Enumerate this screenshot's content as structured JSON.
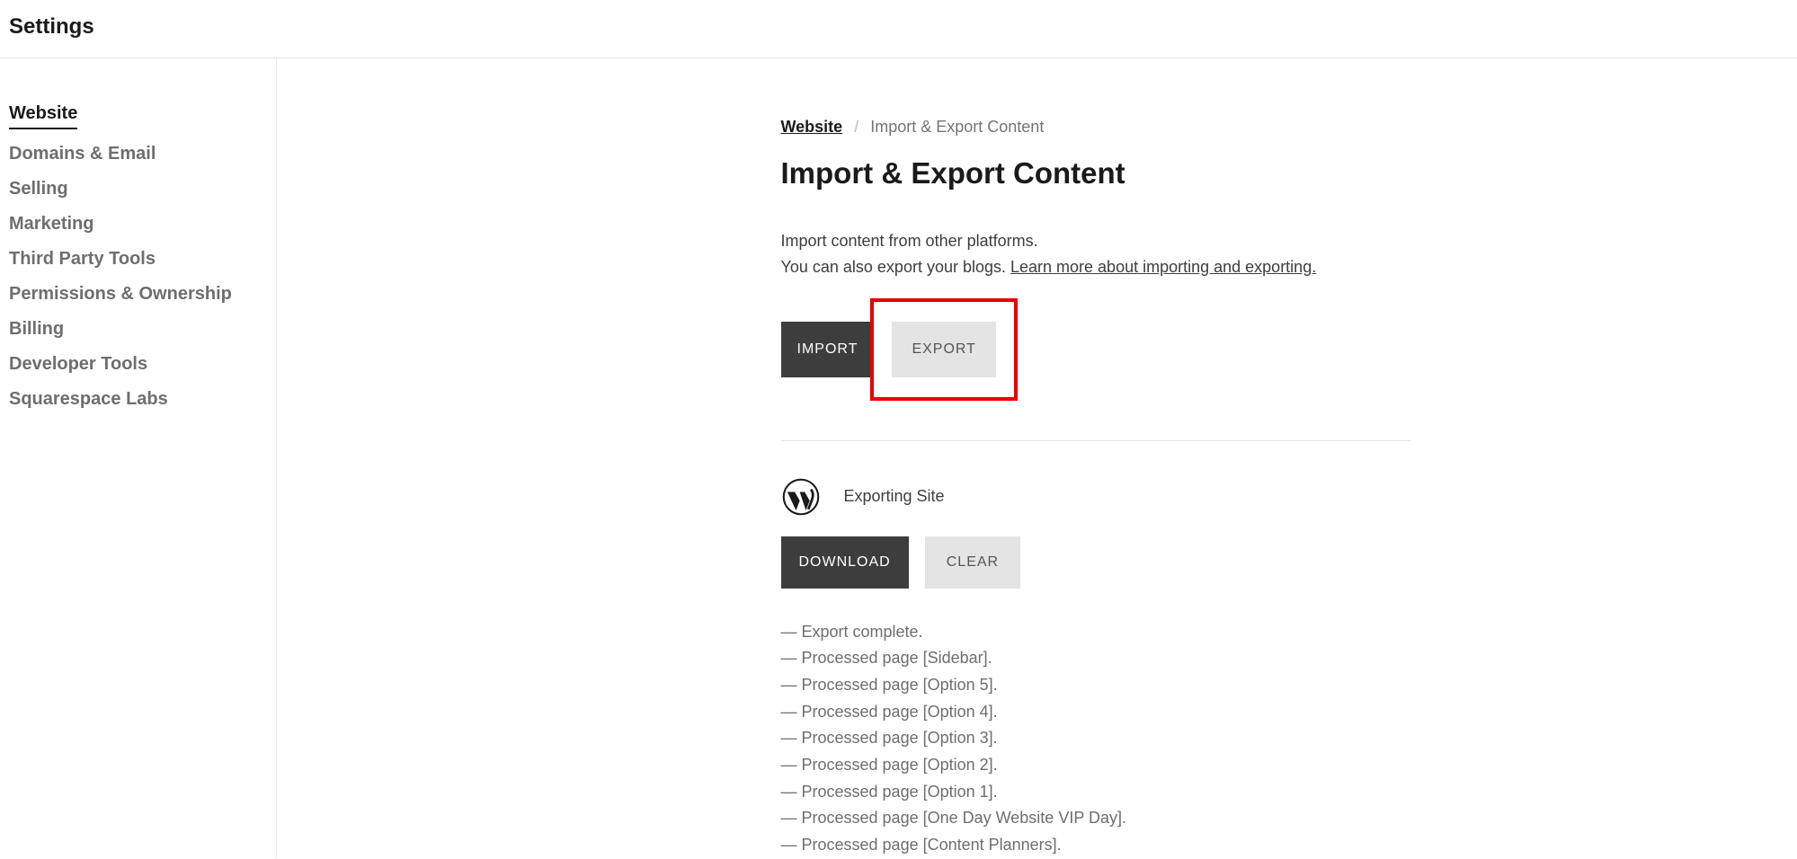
{
  "header": {
    "title": "Settings"
  },
  "sidebar": {
    "items": [
      {
        "label": "Website",
        "active": true
      },
      {
        "label": "Domains & Email",
        "active": false
      },
      {
        "label": "Selling",
        "active": false
      },
      {
        "label": "Marketing",
        "active": false
      },
      {
        "label": "Third Party Tools",
        "active": false
      },
      {
        "label": "Permissions & Ownership",
        "active": false
      },
      {
        "label": "Billing",
        "active": false
      },
      {
        "label": "Developer Tools",
        "active": false
      },
      {
        "label": "Squarespace Labs",
        "active": false
      }
    ]
  },
  "breadcrumb": {
    "root": "Website",
    "separator": "/",
    "current": "Import & Export Content"
  },
  "page": {
    "title": "Import & Export Content",
    "desc_line1": "Import content from other platforms.",
    "desc_line2_prefix": "You can also export your blogs. ",
    "desc_link": "Learn more about importing and exporting."
  },
  "tabs": {
    "import_label": "IMPORT",
    "export_label": "EXPORT"
  },
  "export": {
    "status": "Exporting Site",
    "download_label": "DOWNLOAD",
    "clear_label": "CLEAR"
  },
  "log": [
    "— Export complete.",
    "— Processed page [Sidebar].",
    "— Processed page [Option 5].",
    "— Processed page [Option 4].",
    "— Processed page [Option 3].",
    "— Processed page [Option 2].",
    "— Processed page [Option 1].",
    "— Processed page [One Day Website VIP Day].",
    "— Processed page [Content Planners]."
  ]
}
